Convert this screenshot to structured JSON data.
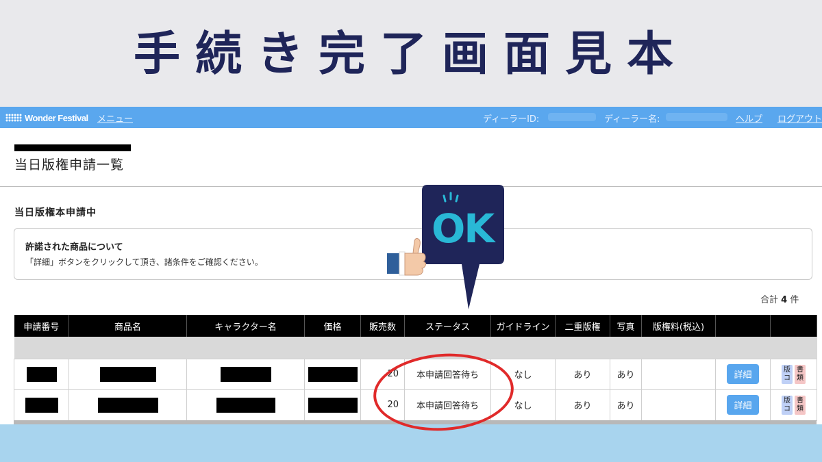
{
  "banner": {
    "title": "手続き完了画面見本"
  },
  "navbar": {
    "logo": "Wonder Festival",
    "menu": "メニュー",
    "dealer_id_label": "ディーラーID:",
    "dealer_name_label": "ディーラー名:",
    "help": "ヘルプ",
    "logout": "ログアウト"
  },
  "page": {
    "heading": "当日版権申請一覧",
    "section_title": "当日版権本申請中",
    "notice": {
      "title": "許諾された商品について",
      "text": "「詳細」ボタンをクリックして頂き、諸条件をご確認ください。"
    },
    "total_prefix": "合計",
    "total_count": "4",
    "total_suffix": "件"
  },
  "table": {
    "headers": [
      "申請番号",
      "商品名",
      "キャラクター名",
      "価格",
      "販売数",
      "ステータス",
      "ガイドライン",
      "二重版権",
      "写真",
      "版権料(税込)",
      "",
      ""
    ],
    "rows": [
      {
        "quantity": "20",
        "status": "本申請回答待ち",
        "guideline": "なし",
        "double_rights": "あり",
        "photo": "あり",
        "fee": "",
        "detail_button": "詳細",
        "tag1": "版コ",
        "tag2": "書類"
      },
      {
        "quantity": "20",
        "status": "本申請回答待ち",
        "guideline": "なし",
        "double_rights": "あり",
        "photo": "あり",
        "fee": "",
        "detail_button": "詳細",
        "tag1": "版コ",
        "tag2": "書類"
      }
    ]
  },
  "overlay": {
    "ok": "OK"
  },
  "colors": {
    "navbar": "#5aa7ee",
    "banner_text": "#1f2559",
    "ok_bubble": "#1f2559",
    "ok_text": "#29b8d6",
    "circle": "#e02a2a",
    "bottom_band": "#a8d4ee"
  }
}
